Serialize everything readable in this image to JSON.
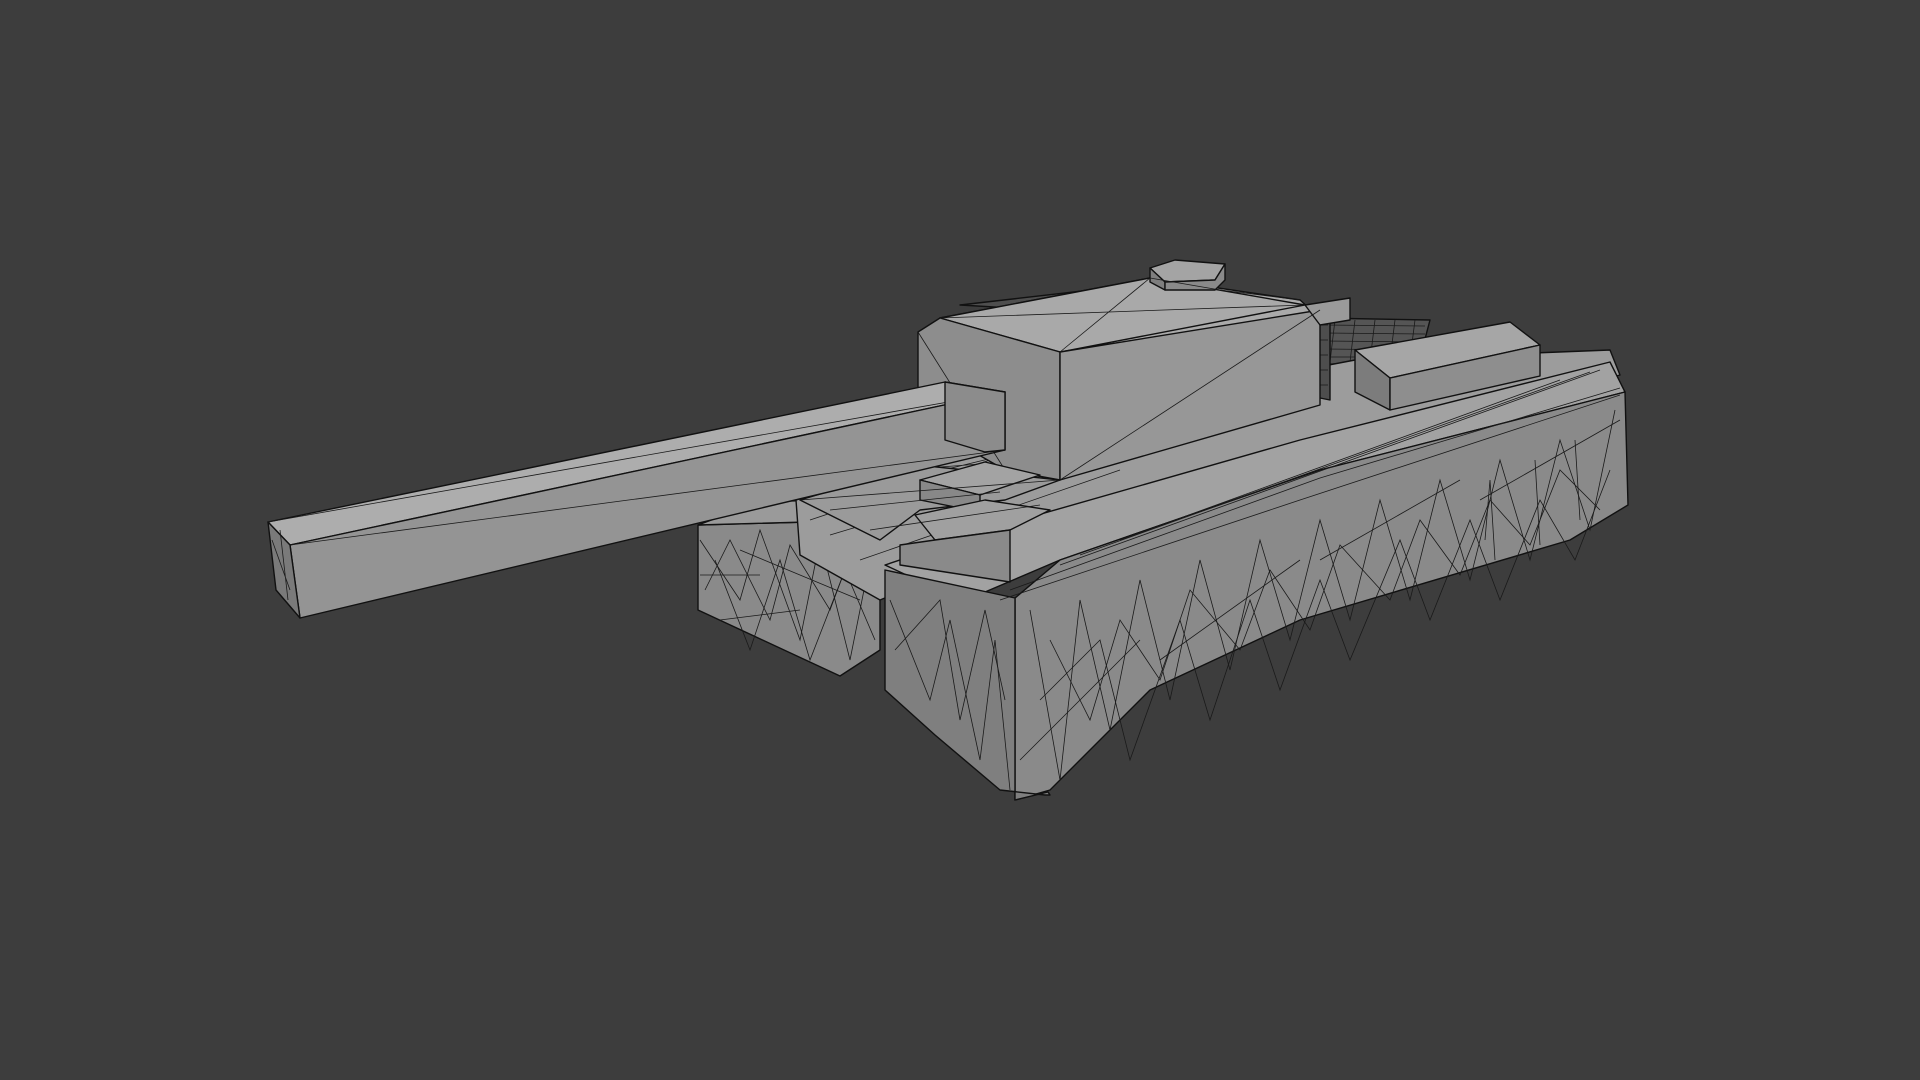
{
  "viewport": {
    "background_color": "#3d3d3d",
    "shading": "solid",
    "overlay": "wireframe",
    "object": "tank-mesh"
  },
  "colors": {
    "top_face": "#a8a8a8",
    "side_face": "#8c8c8c",
    "dark_face": "#6e6e6e",
    "wire": "#111111"
  }
}
